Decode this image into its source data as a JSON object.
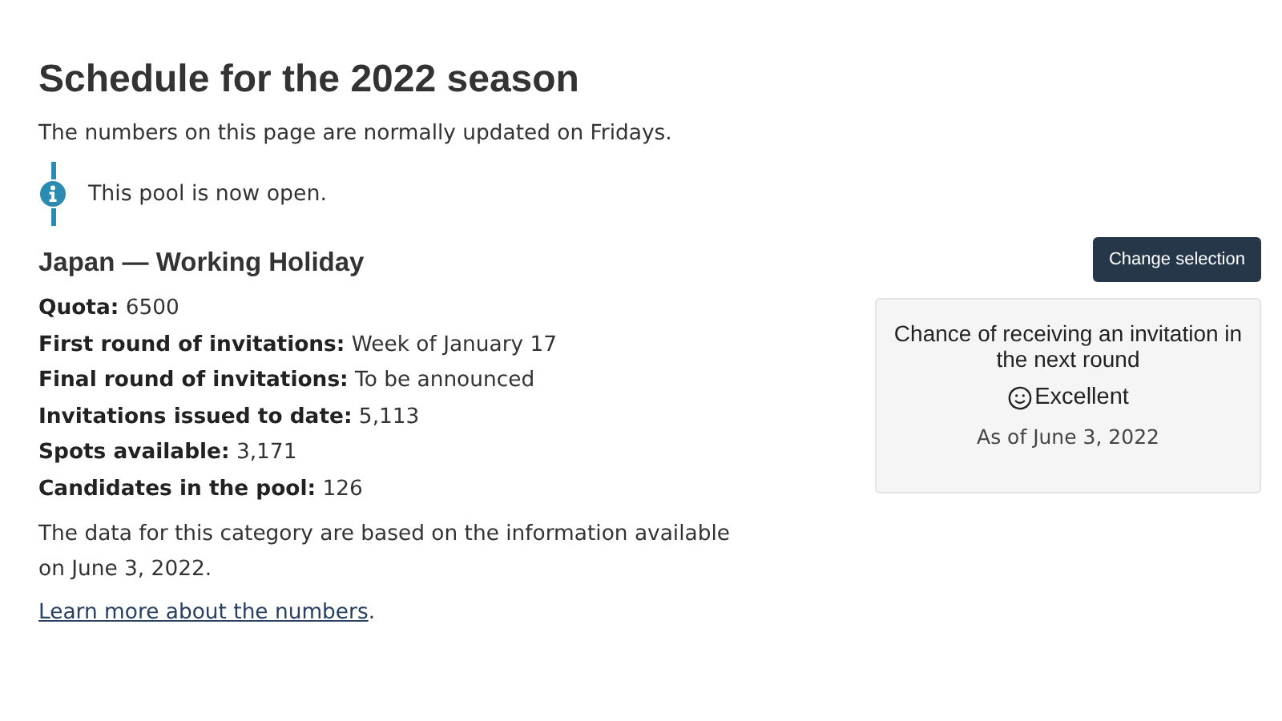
{
  "title": "Schedule for the 2022 season",
  "subtitle": "The numbers on this page are normally updated on Fridays.",
  "notice": {
    "text": "This pool is now open."
  },
  "category": {
    "title": "Japan — Working Holiday"
  },
  "button": "Change selection",
  "stats": [
    {
      "label": "Quota:",
      "value": "6500"
    },
    {
      "label": "First round of invitations:",
      "value": "Week of January 17"
    },
    {
      "label": "Final round of invitations:",
      "value": "To be announced"
    },
    {
      "label": "Invitations issued to date:",
      "value": "5,113"
    },
    {
      "label": "Spots available:",
      "value": "3,171"
    },
    {
      "label": "Candidates in the pool:",
      "value": "126"
    }
  ],
  "note": "The data for this category are based on the information available on June 3, 2022.",
  "more": {
    "link": "Learn more about the numbers",
    "after": "."
  },
  "chance_card": {
    "heading": "Chance of receiving an invitation in the next round",
    "rating": "Excellent",
    "date": "As of June 3, 2022"
  }
}
